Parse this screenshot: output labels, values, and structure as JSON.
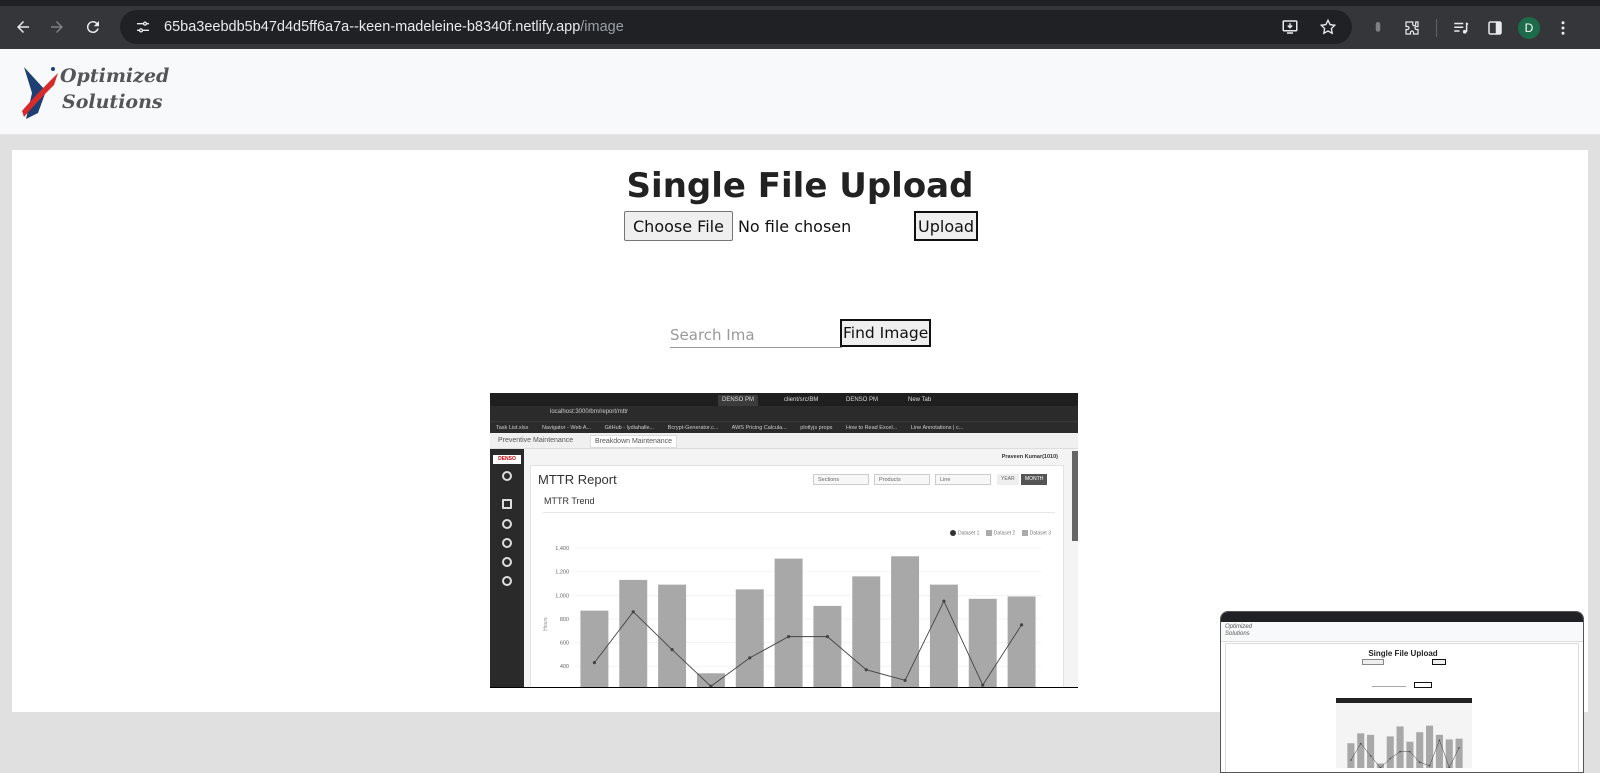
{
  "browser": {
    "url_host": "65ba3eebdb5b47d4d5ff6a7a--keen-madeleine-b8340f.netlify.app",
    "url_path": "/image",
    "profile_initial": "D"
  },
  "site": {
    "logo_line1": "Optimized",
    "logo_line2": "Solutions"
  },
  "upload": {
    "title": "Single File Upload",
    "choose_label": "Choose File",
    "file_status": "No file chosen",
    "upload_label": "Upload"
  },
  "search": {
    "placeholder": "Search Ima",
    "find_label": "Find Image"
  },
  "result_image": {
    "browser_tabs": [
      "DENSO PM",
      "client/src/BM",
      "DENSO PM",
      "New Tab"
    ],
    "url": "localhost:3000/bm/report/mttr",
    "bookmarks": [
      "Task List.xlsx",
      "Navigator - Web A...",
      "GitHub - lydiahalle...",
      "Bcrypt-Generator.c...",
      "AWS Pricing Calcula...",
      "plotlyjs props",
      "How to Read Excel...",
      "Line Annotations | c..."
    ],
    "app_tabs": [
      "Preventive Maintenance",
      "Breakdown Maintenance"
    ],
    "sidebar_logo": "DENSO",
    "user": "Praveen Kumar(1010)",
    "report_title": "MTTR Report",
    "filters": [
      "Sections",
      "Products",
      "Line"
    ],
    "toggles": [
      "YEAR",
      "MONTH"
    ],
    "chart_title": "MTTR Trend",
    "legend": [
      "Dataset 1",
      "Dataset 2",
      "Dataset 3"
    ],
    "y_label": "Hours",
    "y_ticks": [
      "1,400",
      "1,200",
      "1,000",
      "800",
      "600",
      "400"
    ]
  },
  "thumbnail": {
    "logo_line1": "Optimized",
    "logo_line2": "Solutions",
    "title": "Single File Upload"
  },
  "chart_data": {
    "type": "bar",
    "title": "MTTR Trend",
    "ylabel": "Hours",
    "ylim": [
      300,
      1400
    ],
    "bar_values": [
      870,
      1130,
      1090,
      340,
      1050,
      1310,
      910,
      1160,
      1330,
      1090,
      970,
      990
    ],
    "line_values": [
      430,
      860,
      540,
      230,
      470,
      650,
      650,
      370,
      280,
      950,
      240,
      750
    ],
    "colors": {
      "bar": "#a8a8a8",
      "line": "#444444"
    }
  }
}
